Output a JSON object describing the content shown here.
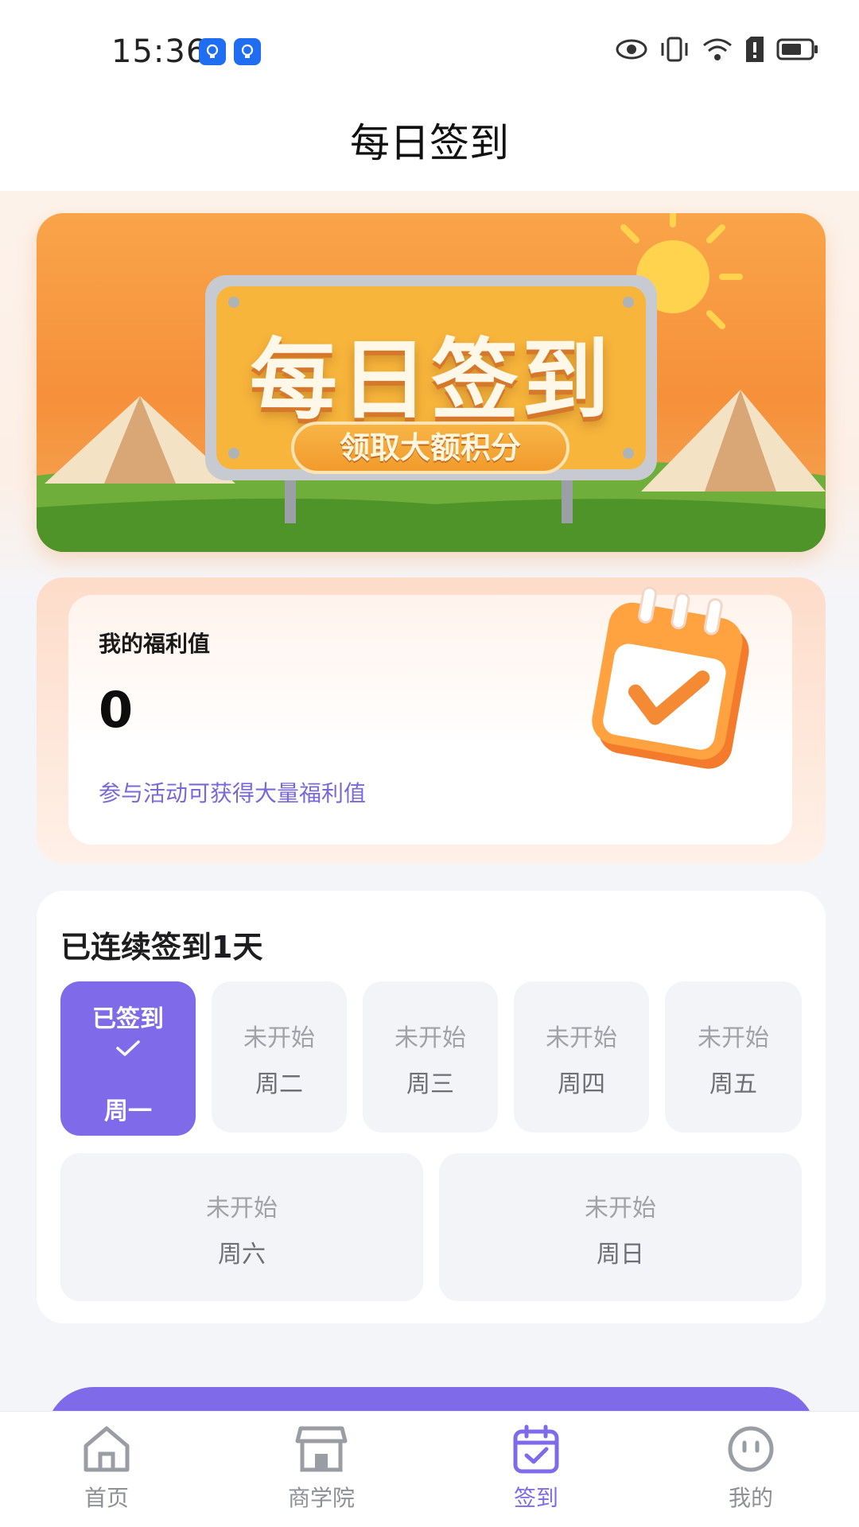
{
  "status_bar": {
    "time": "15:36"
  },
  "header": {
    "title": "每日签到"
  },
  "banner": {
    "title": "每日签到",
    "subtitle": "领取大额积分"
  },
  "welfare": {
    "label": "我的福利值",
    "value": "0",
    "hint": "参与活动可获得大量福利值"
  },
  "sign_in": {
    "title": "已连续签到1天",
    "days": [
      {
        "status": "已签到",
        "weekday": "周一",
        "signed": true
      },
      {
        "status": "未开始",
        "weekday": "周二",
        "signed": false
      },
      {
        "status": "未开始",
        "weekday": "周三",
        "signed": false
      },
      {
        "status": "未开始",
        "weekday": "周四",
        "signed": false
      },
      {
        "status": "未开始",
        "weekday": "周五",
        "signed": false
      },
      {
        "status": "未开始",
        "weekday": "周六",
        "signed": false
      },
      {
        "status": "未开始",
        "weekday": "周日",
        "signed": false
      }
    ]
  },
  "tabs": [
    {
      "label": "首页",
      "icon": "home-icon",
      "active": false
    },
    {
      "label": "商学院",
      "icon": "store-icon",
      "active": false
    },
    {
      "label": "签到",
      "icon": "calendar-check-icon",
      "active": true
    },
    {
      "label": "我的",
      "icon": "profile-icon",
      "active": false
    }
  ],
  "colors": {
    "accent": "#7f6bea",
    "banner": "#f6903a",
    "hint": "#7b68d6"
  }
}
